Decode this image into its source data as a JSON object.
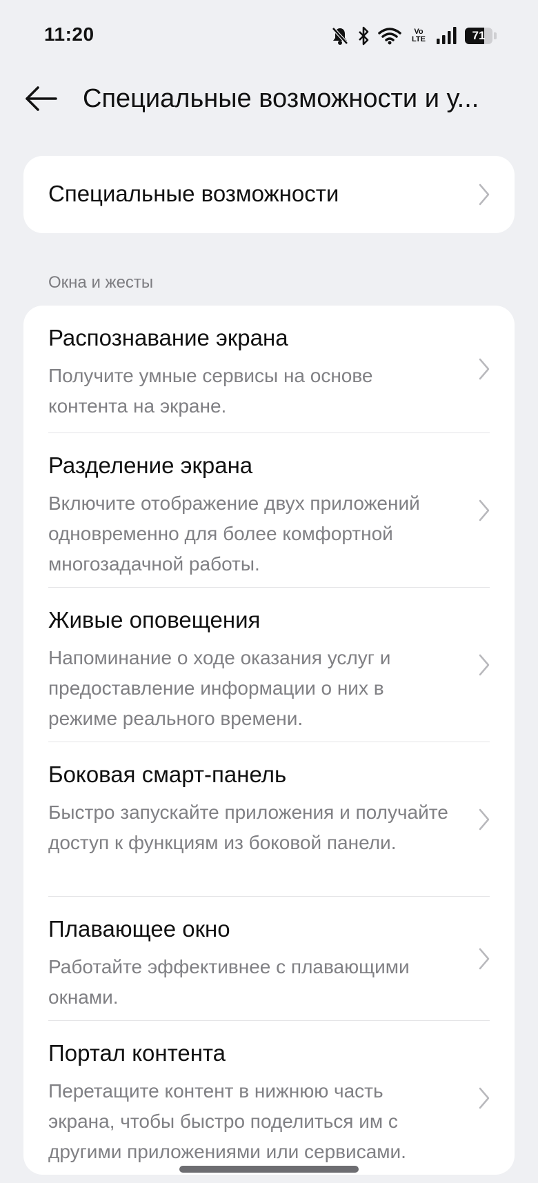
{
  "status_bar": {
    "time": "11:20",
    "volte_top": "Vo",
    "volte_bottom": "LTE",
    "battery_percent": 71,
    "battery_text": "71",
    "icons": [
      "bell-off-icon",
      "bluetooth-icon",
      "wifi-icon",
      "volte-icon",
      "signal-icon",
      "battery-icon"
    ]
  },
  "header": {
    "back_icon": "arrow-left-icon",
    "title": "Специальные возможности и у..."
  },
  "top_card": {
    "title": "Специальные возможности"
  },
  "section": {
    "label": "Окна и жесты"
  },
  "items": [
    {
      "title": "Распознавание экрана",
      "description": "Получите умные сервисы на основе контента на экране."
    },
    {
      "title": "Разделение экрана",
      "description": "Включите отображение двух приложений одновременно для более комфортной многозадачной работы."
    },
    {
      "title": "Живые оповещения",
      "description": "Напоминание о ходе оказания услуг и предоставление информации о них в режиме реального времени."
    },
    {
      "title": "Боковая смарт-панель",
      "description": "Быстро запускайте приложения и получайте доступ к функциям из боковой панели."
    },
    {
      "title": "Плавающее окно",
      "description": "Работайте эффективнее с плавающими окнами."
    },
    {
      "title": "Портал контента",
      "description": "Перетащите контент в нижнюю часть экрана, чтобы быстро поделиться им с другими приложениями или сервисами."
    }
  ],
  "colors": {
    "background": "#eff0f3",
    "card": "#ffffff",
    "title_text": "#111111",
    "secondary_text": "#808084",
    "chevron": "#b8b8bc"
  }
}
